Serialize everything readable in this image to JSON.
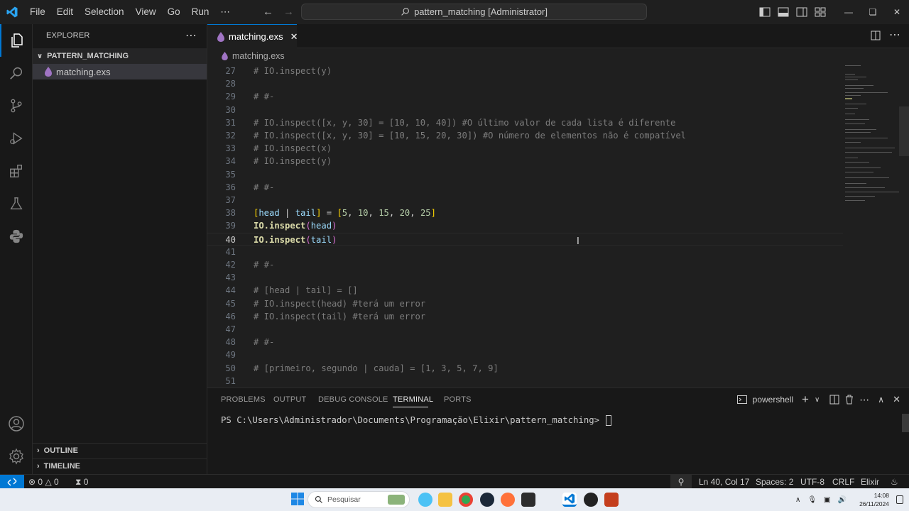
{
  "titlebar": {
    "menu": [
      "File",
      "Edit",
      "Selection",
      "View",
      "Go",
      "Run",
      "⋯"
    ],
    "command_center": "pattern_matching [Administrator]"
  },
  "sidebar": {
    "title": "EXPLORER",
    "more": "⋯",
    "folder": "PATTERN_MATCHING",
    "file": "matching.exs",
    "outline": "OUTLINE",
    "timeline": "TIMELINE"
  },
  "editor": {
    "tab_label": "matching.exs",
    "breadcrumb": "matching.exs",
    "lines": [
      {
        "n": "27",
        "text": "# IO.inspect(y)"
      },
      {
        "n": "28",
        "text": ""
      },
      {
        "n": "29",
        "text": "# #-"
      },
      {
        "n": "30",
        "text": ""
      },
      {
        "n": "31",
        "text": "# IO.inspect([x, y, 30] = [10, 10, 40]) #O último valor de cada lista é diferente"
      },
      {
        "n": "32",
        "text": "# IO.inspect([x, y, 30] = [10, 15, 20, 30]) #O número de elementos não é compatível"
      },
      {
        "n": "33",
        "text": "# IO.inspect(x)"
      },
      {
        "n": "34",
        "text": "# IO.inspect(y)"
      },
      {
        "n": "35",
        "text": ""
      },
      {
        "n": "36",
        "text": "# #-"
      },
      {
        "n": "37",
        "text": ""
      },
      {
        "n": "38",
        "text": "[head | tail] = [5, 10, 15, 20, 25]"
      },
      {
        "n": "39",
        "text": "IO.inspect(head)"
      },
      {
        "n": "40",
        "text": "IO.inspect(tail)"
      },
      {
        "n": "41",
        "text": ""
      },
      {
        "n": "42",
        "text": "# #-"
      },
      {
        "n": "43",
        "text": ""
      },
      {
        "n": "44",
        "text": "# [head | tail] = []"
      },
      {
        "n": "45",
        "text": "# IO.inspect(head) #terá um error"
      },
      {
        "n": "46",
        "text": "# IO.inspect(tail) #terá um error"
      },
      {
        "n": "47",
        "text": ""
      },
      {
        "n": "48",
        "text": "# #-"
      },
      {
        "n": "49",
        "text": ""
      },
      {
        "n": "50",
        "text": "# [primeiro, segundo | cauda] = [1, 3, 5, 7, 9]"
      },
      {
        "n": "51",
        "text": ""
      }
    ],
    "current_line": "40"
  },
  "panel": {
    "tabs": [
      "PROBLEMS",
      "OUTPUT",
      "DEBUG CONSOLE",
      "TERMINAL",
      "PORTS"
    ],
    "active_tab": "TERMINAL",
    "shell": "powershell",
    "prompt": "PS C:\\Users\\Administrador\\Documents\\Programação\\Elixir\\pattern_matching> "
  },
  "statusbar": {
    "errors": "0",
    "warnings": "0",
    "ports": "0",
    "position": "Ln 40, Col 17",
    "spaces": "Spaces: 2",
    "encoding": "UTF-8",
    "eol": "CRLF",
    "language": "Elixir"
  },
  "taskbar": {
    "search_placeholder": "Pesquisar",
    "time": "14:08",
    "date": "26/11/2024"
  },
  "colors": {
    "accent": "#0078d4",
    "editor_bg": "#1f1f1f",
    "sidebar_bg": "#181818"
  }
}
